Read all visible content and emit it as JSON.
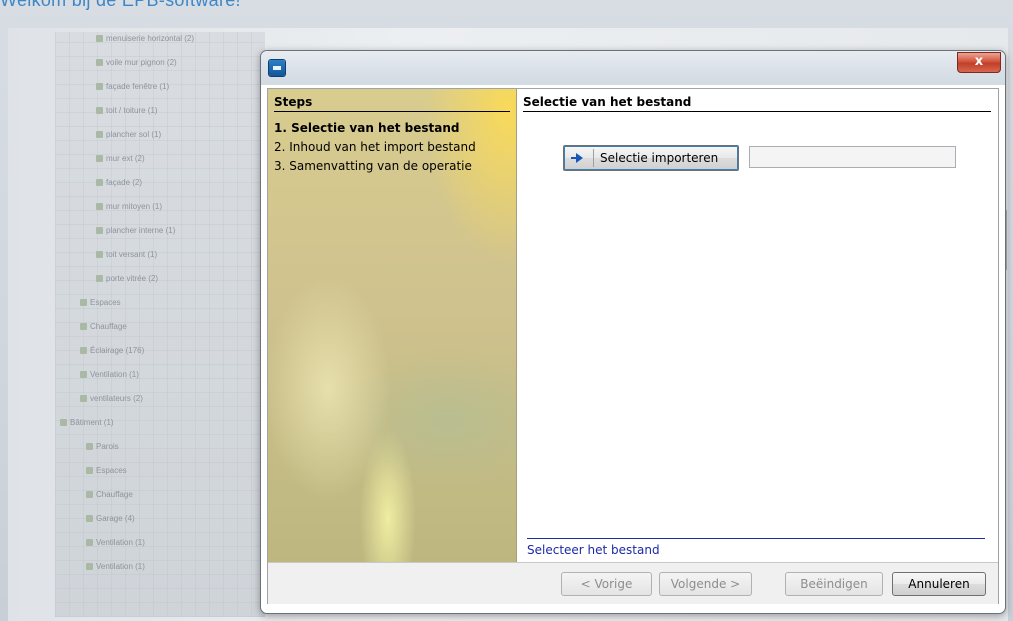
{
  "background": {
    "title": "Welkom bij de EPB-software!",
    "tree_items": [
      "menuiserie horizontal (2)",
      "voile mur pignon (2)",
      "façade fenêtre (1)",
      "toit / toiture (1)",
      "plancher sol (1)",
      "mur ext (2)",
      "façade (2)",
      "mur mitoyen (1)",
      "plancher interne (1)",
      "toit versant (1)",
      "porte vitrée (2)",
      "Espaces",
      "Chauffage",
      "Éclairage (176)",
      "Ventilation (1)",
      "ventilateurs (2)",
      "Bâtiment (1)",
      "Parois",
      "Espaces",
      "Chauffage",
      "Garage (4)",
      "Ventilation (1)",
      "Ventilation (1)"
    ]
  },
  "dialog": {
    "close_glyph": "x",
    "steps": {
      "header": "Steps",
      "items": [
        "1. Selectie van het bestand",
        "2. Inhoud van het import bestand",
        "3. Samenvatting van de operatie"
      ]
    },
    "main": {
      "header": "Selectie van het bestand",
      "import_button": "Selectie importeren",
      "file_value": "",
      "status": "Selecteer het bestand"
    },
    "footer": {
      "prev": "< Vorige",
      "next": "Volgende >",
      "finish": "Beëindigen",
      "cancel": "Annuleren"
    }
  }
}
